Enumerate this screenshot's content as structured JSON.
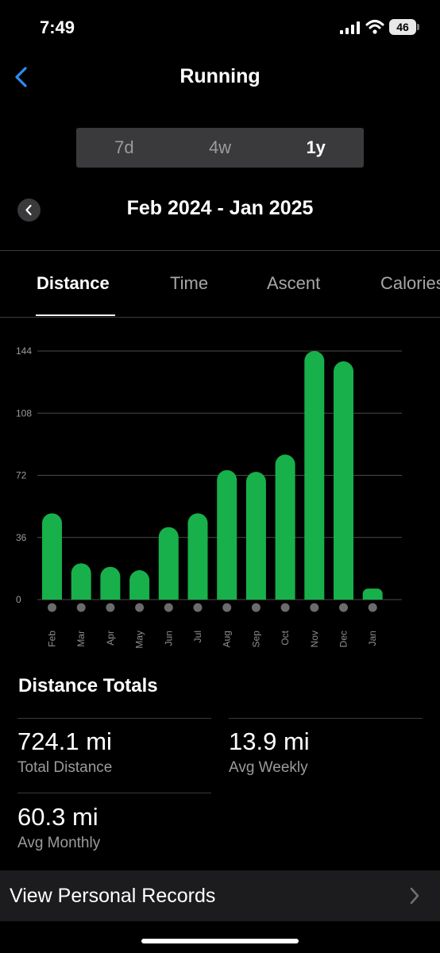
{
  "status": {
    "time": "7:49",
    "battery": "46"
  },
  "nav": {
    "title": "Running",
    "back_icon": "chevron-left-icon"
  },
  "range": {
    "options": [
      "7d",
      "4w",
      "1y"
    ],
    "selected": "1y"
  },
  "period": {
    "label": "Feb 2024 - Jan 2025",
    "prev_icon": "chevron-left-icon"
  },
  "metric_tabs": {
    "items": [
      "Distance",
      "Time",
      "Ascent",
      "Calories"
    ],
    "selected": "Distance"
  },
  "chart_data": {
    "type": "bar",
    "categories": [
      "Feb",
      "Mar",
      "Apr",
      "May",
      "Jun",
      "Jul",
      "Aug",
      "Sep",
      "Oct",
      "Nov",
      "Dec",
      "Jan"
    ],
    "values": [
      50,
      21,
      19,
      17,
      42,
      50,
      75,
      74,
      84,
      144,
      138,
      6.4
    ],
    "yticks": [
      "0",
      "36",
      "72",
      "108",
      "144"
    ],
    "ylim": [
      0,
      144
    ],
    "grid": true,
    "bar_color": "#18b04a",
    "title": "",
    "xlabel": "",
    "ylabel": ""
  },
  "totals": {
    "title": "Distance Totals",
    "stats": [
      {
        "value": "724.1 mi",
        "label": "Total Distance"
      },
      {
        "value": "13.9 mi",
        "label": "Avg Weekly"
      },
      {
        "value": "60.3 mi",
        "label": "Avg Monthly"
      }
    ]
  },
  "records": {
    "label": "View Personal Records",
    "chevron_icon": "chevron-right-icon"
  },
  "colors": {
    "accent": "#18b04a",
    "background": "#000000",
    "surface": "#3a3a3c",
    "row_surface": "#1c1c1e",
    "secondary_text": "#9b9b9b"
  }
}
